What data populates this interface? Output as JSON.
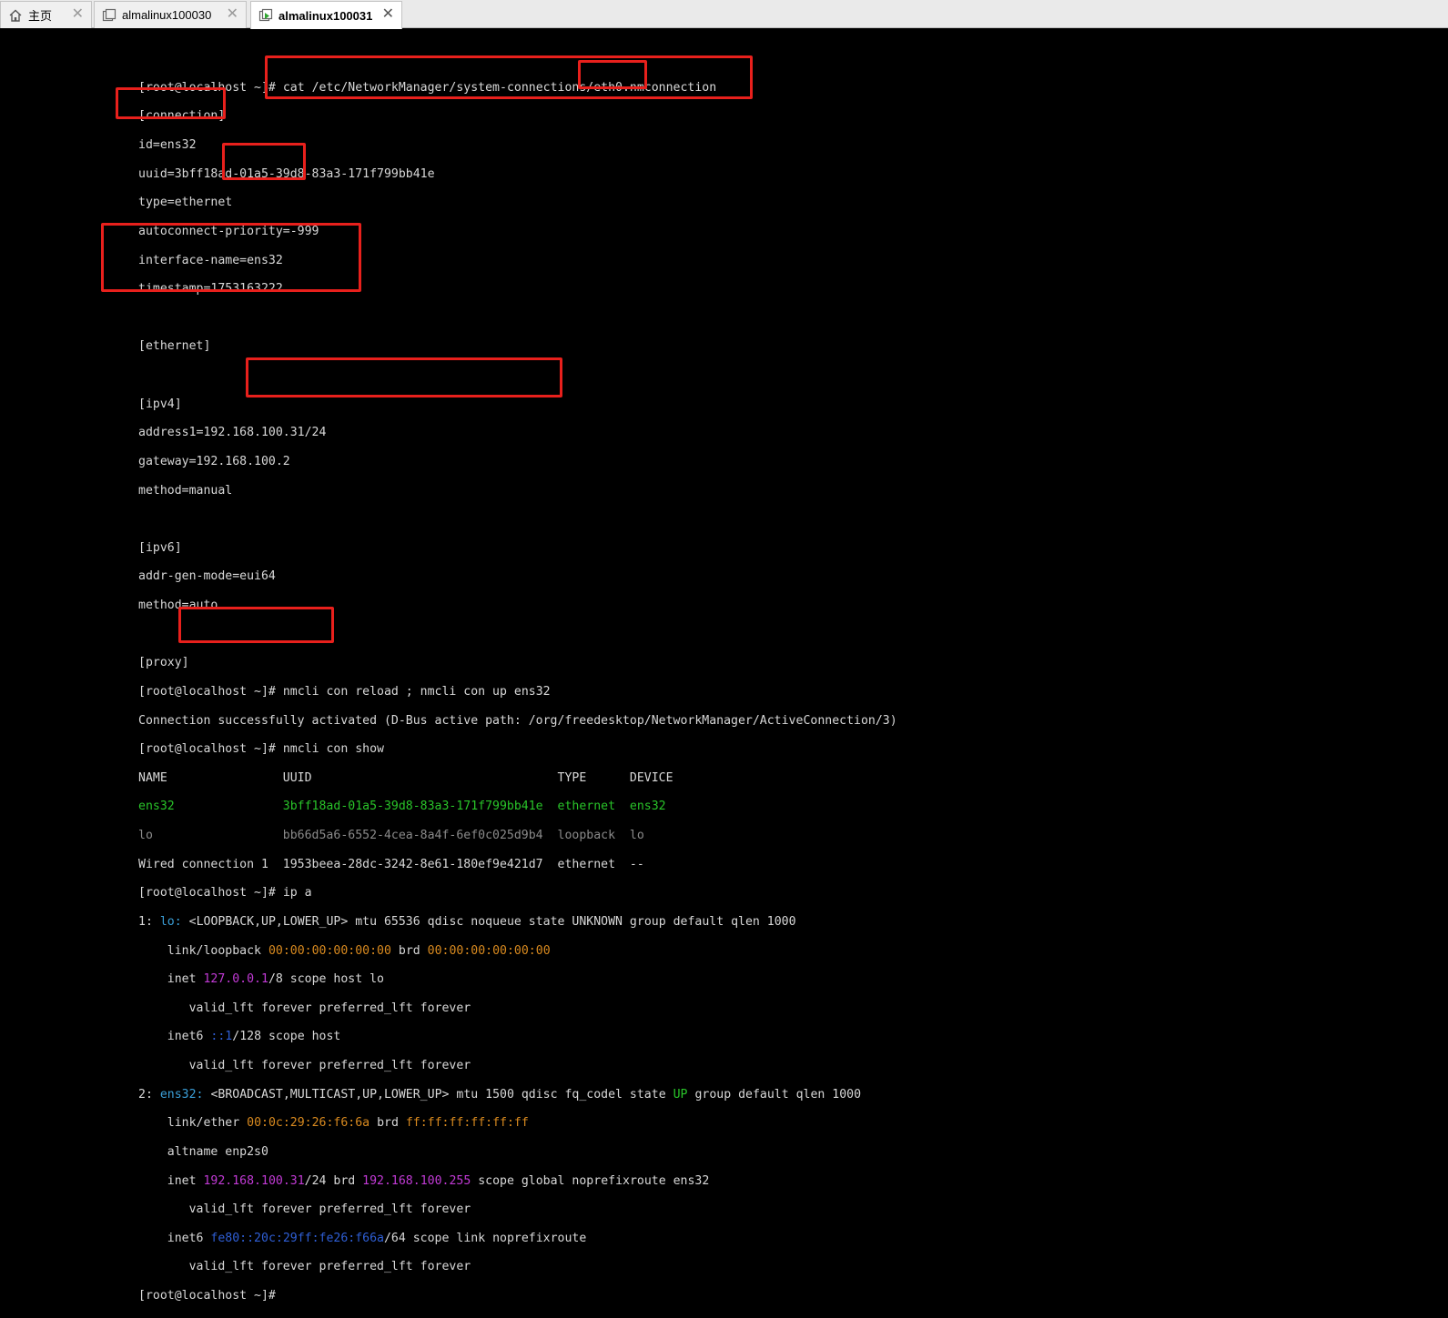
{
  "tabs": [
    {
      "label": "主页",
      "icon": "home-icon",
      "active": false
    },
    {
      "label": "almalinux100030",
      "icon": "vm-icon",
      "active": false
    },
    {
      "label": "almalinux100031",
      "icon": "vm-running-icon",
      "active": true
    }
  ],
  "close_glyph": "✕",
  "colors": {
    "accent_red": "#e8201c",
    "green": "#29c429",
    "magenta": "#c23ad6",
    "orange": "#d98a1f",
    "blue": "#3b9fd8"
  },
  "terminal": {
    "prompt": "[root@localhost ~]#",
    "cmd_cat": "cat /etc/NetworkManager/system-connections/eth0.nmconnection",
    "conf": {
      "connection": "[connection]",
      "id": "id=ens32",
      "uuid": "uuid=3bff18ad-01a5-39d8-83a3-171f799bb41e",
      "type": "type=ethernet",
      "autoconnect": "autoconnect-priority=-999",
      "iface": "interface-name=ens32",
      "timestamp": "timestamp=1753163222",
      "ethernet": "[ethernet]",
      "ipv4": "[ipv4]",
      "address1": "address1=192.168.100.31/24",
      "gateway": "gateway=192.168.100.2",
      "method4": "method=manual",
      "ipv6": "[ipv6]",
      "addrgen": "addr-gen-mode=eui64",
      "method6": "method=auto",
      "proxy": "[proxy]"
    },
    "cmd_reload": "nmcli con reload ; nmcli con up ens32",
    "activated": "Connection successfully activated (D-Bus active path: /org/freedesktop/NetworkManager/ActiveConnection/3)",
    "cmd_show": "nmcli con show",
    "show_header": {
      "name": "NAME",
      "uuid": "UUID",
      "type": "TYPE",
      "device": "DEVICE"
    },
    "show_rows": [
      {
        "name": "ens32",
        "uuid": "3bff18ad-01a5-39d8-83a3-171f799bb41e",
        "type": "ethernet",
        "device": "ens32"
      },
      {
        "name": "lo",
        "uuid": "bb66d5a6-6552-4cea-8a4f-6ef0c025d9b4",
        "type": "loopback",
        "device": "lo"
      },
      {
        "name": "Wired connection 1",
        "uuid": "1953beea-28dc-3242-8e61-180ef9e421d7",
        "type": "ethernet",
        "device": "--"
      }
    ],
    "cmd_ipa": "ip a",
    "ipa": {
      "lo_num": "1:",
      "lo_name": "lo:",
      "lo_flags": "<LOOPBACK,UP,LOWER_UP> mtu 65536 qdisc noqueue state UNKNOWN group default qlen 1000",
      "lo_link_pre": "link/loopback",
      "lo_mac": "00:00:00:00:00:00",
      "lo_brd_word": "brd",
      "lo_brd": "00:00:00:00:00:00",
      "lo_inet_pre": "inet",
      "lo_inet_ip": "127.0.0.1",
      "lo_inet_post": "/8 scope host lo",
      "valid": "valid_lft forever preferred_lft forever",
      "lo_inet6_pre": "inet6",
      "lo_inet6_ip": "::1",
      "lo_inet6_post": "/128 scope host",
      "ens_num": "2:",
      "ens_name": "ens32:",
      "ens_flags": "<BROADCAST,MULTICAST,UP,LOWER_UP> mtu 1500 qdisc fq_codel state",
      "ens_state": "UP",
      "ens_flags_post": "group default qlen 1000",
      "ens_link_pre": "link/ether",
      "ens_mac": "00:0c:29:26:f6:6a",
      "ens_brd_word": "brd",
      "ens_brd": "ff:ff:ff:ff:ff:ff",
      "altname": "altname enp2s0",
      "ens_inet_pre": "inet",
      "ens_inet_ip": "192.168.100.31",
      "ens_inet_mid": "/24 brd",
      "ens_inet_brd": "192.168.100.255",
      "ens_inet_post": "scope global noprefixroute ens32",
      "ens_inet6_pre": "inet6",
      "ens_inet6_ip": "fe80::20c:29ff:fe26:f66a",
      "ens_inet6_post": "/64 scope link noprefixroute"
    }
  }
}
